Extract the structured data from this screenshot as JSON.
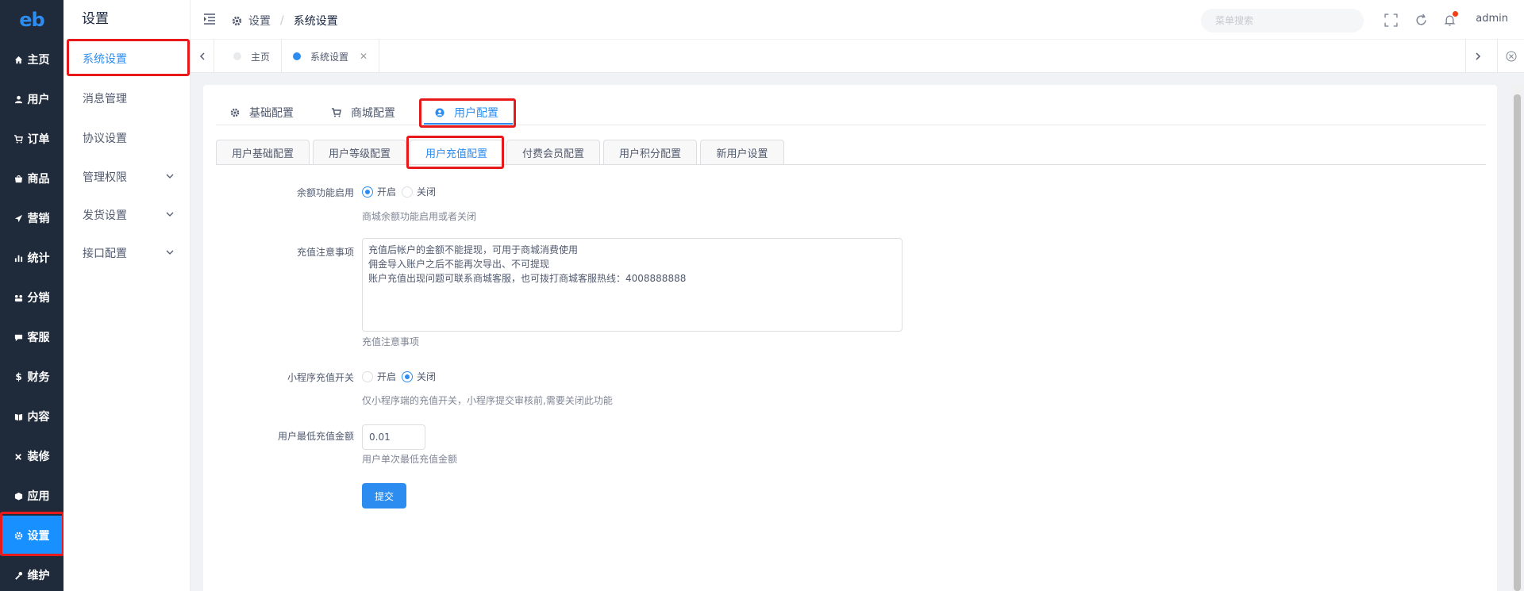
{
  "nav": {
    "logo": "eb",
    "items": [
      {
        "label": "主页",
        "icon": "home-icon"
      },
      {
        "label": "用户",
        "icon": "user-icon"
      },
      {
        "label": "订单",
        "icon": "cart-icon"
      },
      {
        "label": "商品",
        "icon": "shop-icon"
      },
      {
        "label": "营销",
        "icon": "send-icon"
      },
      {
        "label": "统计",
        "icon": "bar-chart-icon"
      },
      {
        "label": "分销",
        "icon": "share-icon"
      },
      {
        "label": "客服",
        "icon": "chat-icon"
      },
      {
        "label": "财务",
        "icon": "dollar-icon"
      },
      {
        "label": "内容",
        "icon": "book-icon"
      },
      {
        "label": "装修",
        "icon": "tools-icon"
      },
      {
        "label": "应用",
        "icon": "cube-icon"
      },
      {
        "label": "设置",
        "icon": "gear-icon",
        "active": true
      },
      {
        "label": "维护",
        "icon": "wrench-icon"
      }
    ]
  },
  "submenu": {
    "title": "设置",
    "items": [
      {
        "label": "系统设置",
        "active": true
      },
      {
        "label": "消息管理"
      },
      {
        "label": "协议设置"
      },
      {
        "label": "管理权限",
        "expandable": true
      },
      {
        "label": "发货设置",
        "expandable": true
      },
      {
        "label": "接口配置",
        "expandable": true
      }
    ]
  },
  "topbar": {
    "breadcrumb": [
      "设置",
      "系统设置"
    ],
    "search_placeholder": "菜单搜索",
    "user": "admin"
  },
  "page_tabs": [
    {
      "label": "主页"
    },
    {
      "label": "系统设置",
      "active": true
    }
  ],
  "config_tabs": [
    {
      "label": "基础配置",
      "icon": "gear-icon"
    },
    {
      "label": "商城配置",
      "icon": "cart-icon"
    },
    {
      "label": "用户配置",
      "icon": "user-circle-icon",
      "active": true
    }
  ],
  "sub_tabs": [
    {
      "label": "用户基础配置"
    },
    {
      "label": "用户等级配置"
    },
    {
      "label": "用户充值配置",
      "active": true
    },
    {
      "label": "付费会员配置"
    },
    {
      "label": "用户积分配置"
    },
    {
      "label": "新用户设置"
    }
  ],
  "form": {
    "balance": {
      "label": "余额功能启用",
      "options": [
        "开启",
        "关闭"
      ],
      "selected": "开启",
      "hint": "商城余额功能启用或者关闭"
    },
    "notice": {
      "label": "充值注意事项",
      "value": "充值后帐户的金额不能提现，可用于商城消费使用\n佣金导入账户之后不能再次导出、不可提现\n账户充值出现问题可联系商城客服，也可拨打商城客服热线：4008888888",
      "hint": "充值注意事项"
    },
    "mini_program": {
      "label": "小程序充值开关",
      "options": [
        "开启",
        "关闭"
      ],
      "selected": "关闭",
      "hint": "仅小程序端的充值开关，小程序提交审核前,需要关闭此功能"
    },
    "min_recharge": {
      "label": "用户最低充值金额",
      "value": "0.01",
      "hint": "用户单次最低充值金额"
    },
    "submit_label": "提交"
  },
  "colors": {
    "primary": "#2d8cf0",
    "nav_bg": "#1f2a3a",
    "nav_active": "#1890ff",
    "highlight_box": "#e8191b"
  }
}
